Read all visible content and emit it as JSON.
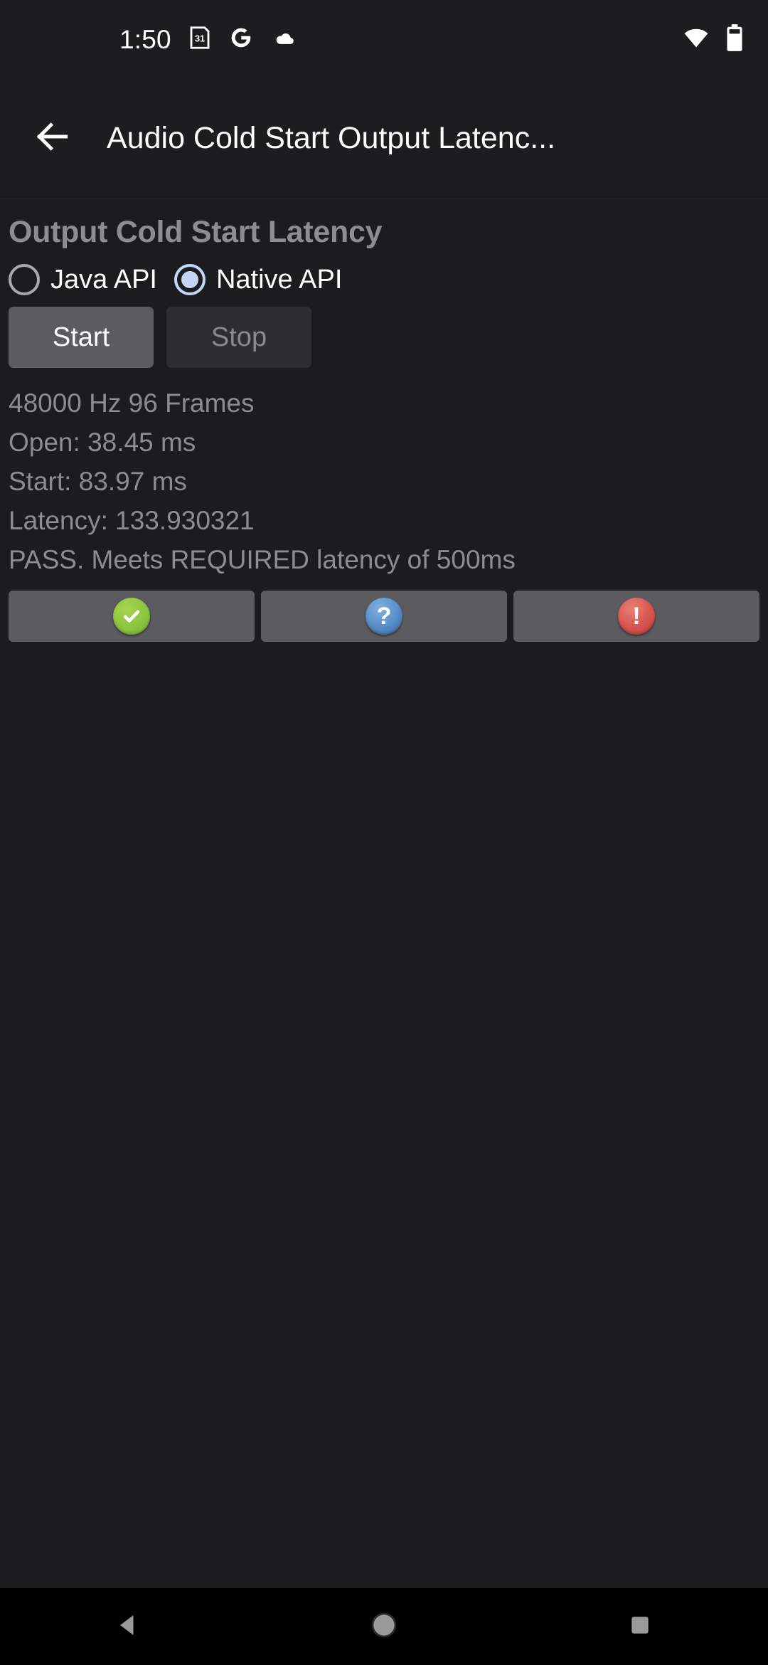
{
  "status_bar": {
    "clock": "1:50",
    "icons_left": [
      "calendar-31-icon",
      "google-g-icon",
      "cloud-icon"
    ],
    "icons_right": [
      "wifi-icon",
      "battery-icon"
    ],
    "calendar_day": "31",
    "google_letter": "G"
  },
  "app_bar": {
    "back_icon": "back-arrow-icon",
    "title": "Audio Cold Start Output Latenc..."
  },
  "main": {
    "heading": "Output Cold Start Latency",
    "radio_group": {
      "options": [
        {
          "label": "Java API",
          "selected": false
        },
        {
          "label": "Native API",
          "selected": true
        }
      ]
    },
    "buttons": [
      {
        "label": "Start",
        "enabled": true
      },
      {
        "label": "Stop",
        "enabled": false
      }
    ],
    "results": [
      "48000 Hz 96 Frames",
      "Open: 38.45 ms",
      "Start: 83.97 ms",
      "Latency: 133.930321",
      "PASS. Meets REQUIRED latency of 500ms"
    ],
    "icon_buttons": [
      {
        "icon": "check-circle-icon",
        "glyph": "",
        "color": "#8cc63e",
        "variant": "green"
      },
      {
        "icon": "question-circle-icon",
        "glyph": "?",
        "color": "#5a8fc8",
        "variant": "blue"
      },
      {
        "icon": "warning-circle-icon",
        "glyph": "!",
        "color": "#d9564e",
        "variant": "red"
      }
    ]
  },
  "nav_bar": {
    "back": "nav-back-icon",
    "home": "nav-home-icon",
    "recents": "nav-recents-icon"
  },
  "colors": {
    "background": "#1c1c1e",
    "app_bar": "#1d1d1f",
    "nav_bar": "#000000",
    "heading_text": "#8d8d91",
    "body_text": "#8d8d91",
    "primary_text": "#ffffff",
    "button_enabled": "#5c5c60",
    "button_disabled": "#2e2e31",
    "radio_selected": "#c3d6f6",
    "radio_unselected": "#a8a8ad",
    "nav_icon": "#9a9a9a"
  }
}
